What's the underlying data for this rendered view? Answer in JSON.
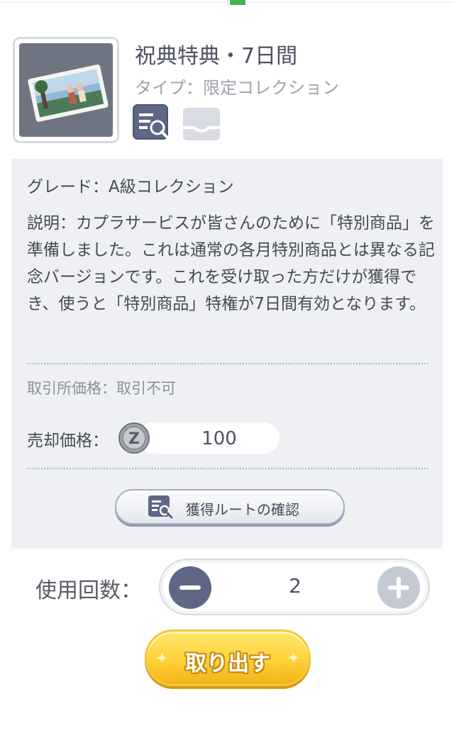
{
  "item": {
    "title": "祝典特典・7日間",
    "type": "タイプ：限定コレクション"
  },
  "details": {
    "grade": "グレード：A級コレクション",
    "description": "説明：カプラサービスが皆さんのために「特別商品」を準備しました。これは通常の各月特別商品とは異なる記念バージョンです。これを受け取った方だけが獲得でき、使うと「特別商品」特権が7日間有効となります。",
    "trade_price": "取引所価格：取引不可",
    "sell_price_label": "売却価格：",
    "sell_price_value": "100",
    "route_button": "獲得ルートの確認"
  },
  "usage": {
    "label": "使用回数：",
    "count": "2"
  },
  "take_button": "取り出す",
  "colors": {
    "accent_yellow": "#ffd23a",
    "stepper_minus": "#5e6786",
    "stepper_plus_disabled": "#c4c9d6",
    "panel_bg": "#eef0f4"
  },
  "icons": {
    "tag_a": "collection-search-icon",
    "tag_b": "tray-icon",
    "coin": "zeny-coin-icon"
  }
}
